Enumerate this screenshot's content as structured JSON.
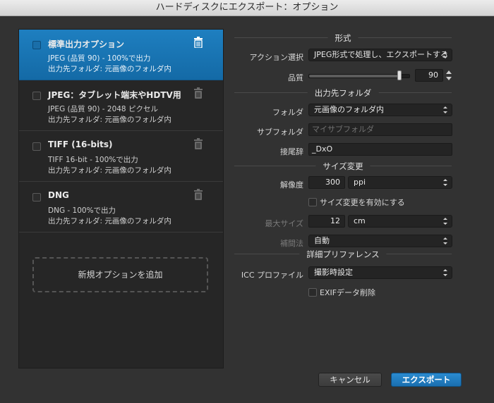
{
  "window": {
    "title": "ハードディスクにエクスポート：オプション"
  },
  "presets": [
    {
      "title": "標準出力オプション",
      "line1": "JPEG (品質 90) - 100%で出力",
      "line2": "出力先フォルダ: 元画像のフォルダ内",
      "selected": true
    },
    {
      "title": "JPEG：タブレット端末やHDTV用",
      "line1": "JPEG (品質 90) - 2048 ピクセル",
      "line2": "出力先フォルダ: 元画像のフォルダ内",
      "selected": false
    },
    {
      "title": "TIFF (16-bits)",
      "line1": "TIFF 16-bit - 100%で出力",
      "line2": "出力先フォルダ: 元画像のフォルダ内",
      "selected": false
    },
    {
      "title": "DNG",
      "line1": "DNG - 100%で出力",
      "line2": "出力先フォルダ: 元画像のフォルダ内",
      "selected": false
    }
  ],
  "add_preset_label": "新規オプションを追加",
  "format": {
    "section": "形式",
    "action_label": "アクション選択",
    "action_value": "JPEG形式で処理し、エクスポートする",
    "quality_label": "品質",
    "quality_value": "90",
    "quality_fraction": 0.9
  },
  "output": {
    "section": "出力先フォルダ",
    "folder_label": "フォルダ",
    "folder_value": "元画像のフォルダ内",
    "subfolder_label": "サブフォルダ",
    "subfolder_placeholder": "マイサブフォルダ",
    "suffix_label": "接尾辞",
    "suffix_value": "_DxO"
  },
  "resize": {
    "section": "サイズ変更",
    "resolution_label": "解像度",
    "resolution_value": "300",
    "resolution_unit": "ppi",
    "enable_label": "サイズ変更を有効にする",
    "max_size_label": "最大サイズ",
    "max_size_value": "12",
    "max_size_unit": "cm",
    "interp_label": "補間法",
    "interp_value": "自動"
  },
  "advanced": {
    "section": "詳細プリファレンス",
    "icc_label": "ICC プロファイル",
    "icc_value": "撮影時設定",
    "exif_label": "EXIFデータ削除"
  },
  "buttons": {
    "cancel": "キャンセル",
    "export": "エクスポート"
  },
  "colors": {
    "accent": "#1a73b8",
    "background": "#323232",
    "panel": "#262626"
  }
}
